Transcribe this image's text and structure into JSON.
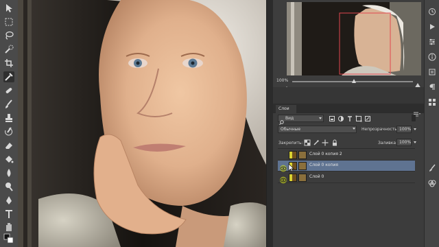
{
  "navigator": {
    "zoom": "100%",
    "zoom_level": 0.5
  },
  "layers_panel": {
    "tab_label": "Слои",
    "filter_kind": "Вид",
    "blend_mode": "Обычные",
    "opacity_label": "Непрозрачность:",
    "opacity_value": "100%",
    "lock_label": "Закрепить:",
    "fill_label": "Заливка:",
    "fill_value": "100%",
    "layers": [
      {
        "name": "Слой 0 копия 2",
        "visible": false,
        "selected": false
      },
      {
        "name": "Слой 0 копия",
        "visible": true,
        "selected": true
      },
      {
        "name": "Слой 0",
        "visible": true,
        "selected": false
      }
    ]
  },
  "colors": {
    "selection_blue": "#5f7391",
    "eye_highlight": "#d6e21a",
    "nav_box": "#e2474f",
    "panel_bg": "#3c3c3c"
  }
}
